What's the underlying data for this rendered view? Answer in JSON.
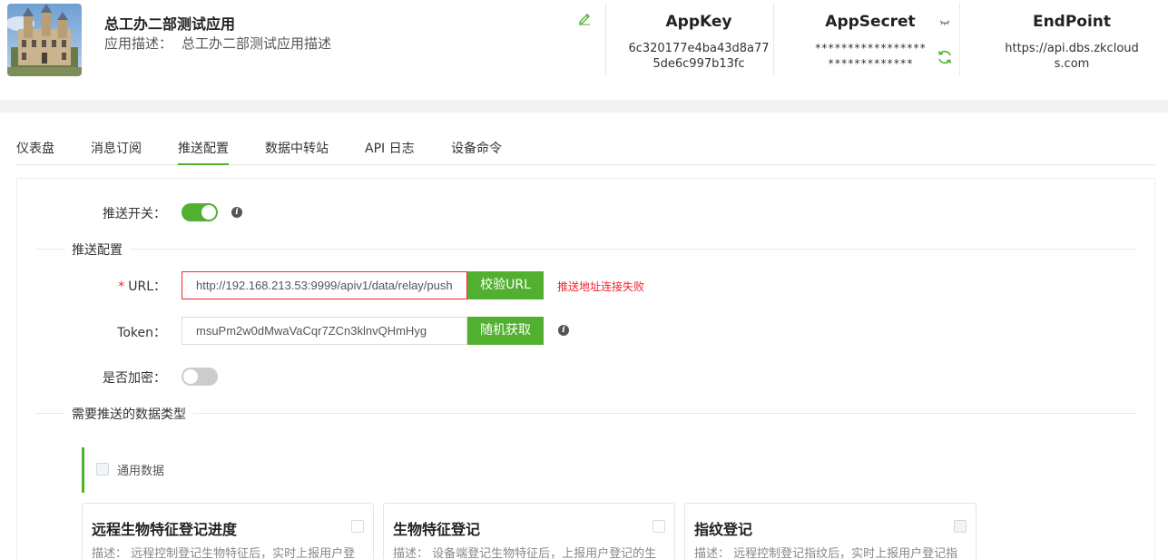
{
  "app": {
    "name": "总工办二部测试应用",
    "desc_label": "应用描述：",
    "desc_value": "总工办二部测试应用描述"
  },
  "appkey": {
    "title": "AppKey",
    "line1": "6c320177e4ba43d8a77",
    "line2": "5de6c997b13fc"
  },
  "appsecret": {
    "title": "AppSecret",
    "line1": "*****************",
    "line2": "*************"
  },
  "endpoint": {
    "title": "EndPoint",
    "line1": "https://api.dbs.zkcloud",
    "line2": "s.com"
  },
  "tabs": [
    "仪表盘",
    "消息订阅",
    "推送配置",
    "数据中转站",
    "API 日志",
    "设备命令"
  ],
  "active_tab": "推送配置",
  "form": {
    "push_switch_label": "推送开关：",
    "push_switch_on": true,
    "section_config": "推送配置",
    "url_required": "*",
    "url_label": "URL：",
    "url_value": "http://192.168.213.53:9999/apiv1/data/relay/push",
    "verify_button": "校验URL",
    "url_error": "推送地址连接失败",
    "token_label": "Token：",
    "token_value": "msuPm2w0dMwaVaCqr7ZCn3klnvQHmHyg",
    "random_button": "随机获取",
    "encrypt_label": "是否加密：",
    "encrypt_on": false,
    "section_types": "需要推送的数据类型"
  },
  "data_group": {
    "label": "通用数据"
  },
  "cards": [
    {
      "title": "远程生物特征登记进度",
      "desc": "描述：  远程控制登记生物特征后，实时上报用户登"
    },
    {
      "title": "生物特征登记",
      "desc": "描述：  设备端登记生物特征后，上报用户登记的生"
    },
    {
      "title": "指纹登记",
      "desc": "描述：  远程控制登记指纹后，实时上报用户登记指"
    }
  ],
  "colors": {
    "accent": "#52b030",
    "error": "#f5222d"
  }
}
